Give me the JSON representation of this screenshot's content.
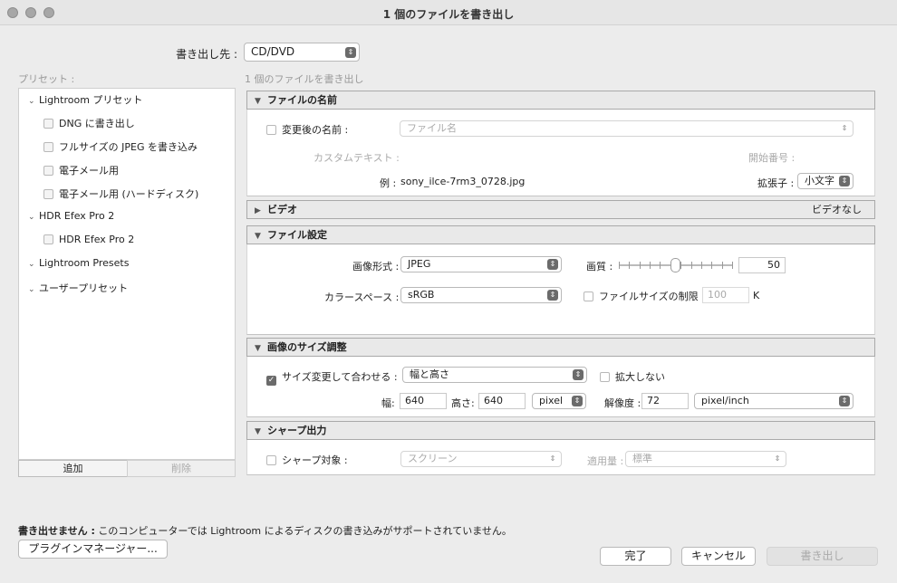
{
  "window": {
    "title": "1 個のファイルを書き出し"
  },
  "destination": {
    "label": "書き出し先 :",
    "value": "CD/DVD"
  },
  "presets": {
    "header": "プリセット :",
    "tree": [
      {
        "label": "Lightroom プリセット"
      },
      {
        "label": "DNG に書き出し"
      },
      {
        "label": "フルサイズの JPEG を書き込み"
      },
      {
        "label": "電子メール用"
      },
      {
        "label": "電子メール用 (ハードディスク)"
      },
      {
        "label": "HDR Efex Pro 2"
      },
      {
        "label": "HDR Efex Pro 2"
      },
      {
        "label": "Lightroom Presets"
      },
      {
        "label": "ユーザープリセット"
      }
    ],
    "add_label": "追加",
    "delete_label": "削除"
  },
  "export_count": "1 個のファイルを書き出し",
  "file_naming": {
    "title": "ファイルの名前",
    "rename_label": "変更後の名前 :",
    "rename_value": "ファイル名",
    "custom_text_label": "カスタムテキスト :",
    "start_number_label": "開始番号 :",
    "example_label": "例 :",
    "example_value": "sony_ilce-7rm3_0728.jpg",
    "extension_label": "拡張子 :",
    "extension_value": "小文字"
  },
  "video": {
    "title": "ビデオ",
    "status": "ビデオなし"
  },
  "file_settings": {
    "title": "ファイル設定",
    "format_label": "画像形式 :",
    "format_value": "JPEG",
    "quality_label": "画質 :",
    "quality_value": "50",
    "quality_fraction": 0.5,
    "colorspace_label": "カラースペース :",
    "colorspace_value": "sRGB",
    "limit_label": "ファイルサイズの制限 :",
    "limit_value": "100",
    "limit_unit": "K"
  },
  "image_sizing": {
    "title": "画像のサイズ調整",
    "resize_label": "サイズ変更して合わせる :",
    "resize_value": "幅と高さ",
    "dont_enlarge_label": "拡大しない",
    "width_label": "幅:",
    "width_value": "640",
    "height_label": "高さ:",
    "height_value": "640",
    "unit_value": "pixel",
    "resolution_label": "解像度 :",
    "resolution_value": "72",
    "resolution_unit": "pixel/inch"
  },
  "sharpening": {
    "title": "シャープ出力",
    "sharpen_label": "シャープ対象 :",
    "sharpen_value": "スクリーン",
    "amount_label": "適用量 :",
    "amount_value": "標準"
  },
  "footer": {
    "warning_bold": "書き出せません :",
    "warning_text": "このコンピューターでは Lightroom によるディスクの書き込みがサポートされていません。",
    "plugin_manager": "プラグインマネージャー...",
    "done": "完了",
    "cancel": "キャンセル",
    "export": "書き出し"
  }
}
